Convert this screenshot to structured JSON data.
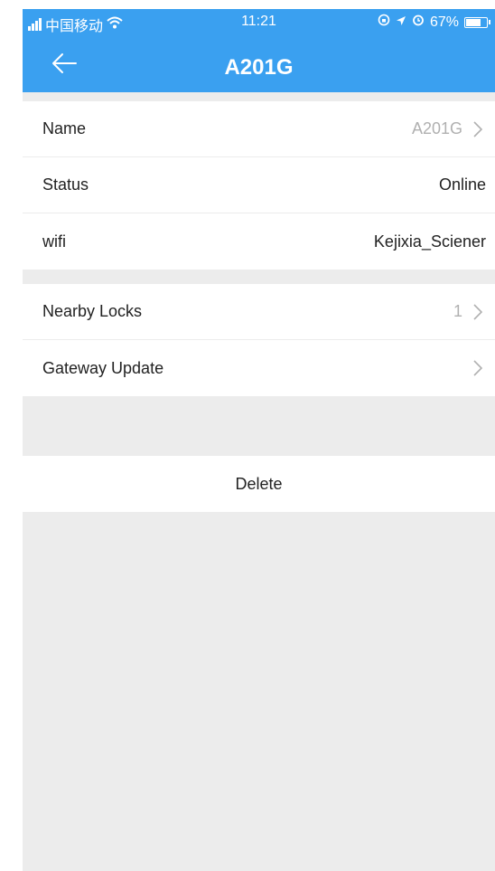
{
  "status_bar": {
    "carrier": "中国移动",
    "time": "11:21",
    "battery_percent": "67%",
    "battery_level": 0.67
  },
  "nav": {
    "title": "A201G",
    "back_icon": "arrow-left-icon"
  },
  "groups": [
    {
      "rows": [
        {
          "label": "Name",
          "value": "A201G",
          "chevron": true
        },
        {
          "label": "Status",
          "value": "Online",
          "chevron": false
        },
        {
          "label": "wifi",
          "value": "Kejixia_Sciener",
          "chevron": false
        }
      ]
    },
    {
      "rows": [
        {
          "label": "Nearby Locks",
          "value": "1",
          "chevron": true
        },
        {
          "label": "Gateway Update",
          "value": "",
          "chevron": true
        }
      ]
    }
  ],
  "delete_label": "Delete",
  "colors": {
    "header": "#3aa0f0",
    "background": "#ececec",
    "secondary_text": "#b0b0b0"
  }
}
